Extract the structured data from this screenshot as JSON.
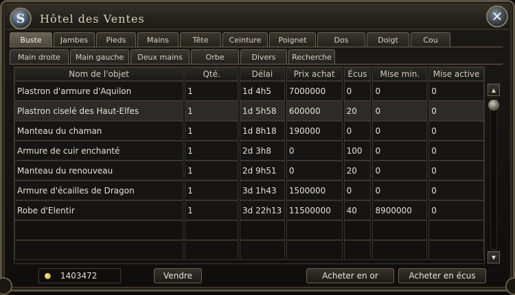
{
  "window": {
    "title": "Hôtel des Ventes"
  },
  "tabs_row1": [
    "Buste",
    "Jambes",
    "Pieds",
    "Mains",
    "Tête",
    "Ceinture",
    "Poignet",
    "Dos",
    "Doigt",
    "Cou"
  ],
  "tabs_row2": [
    "Main droite",
    "Main gauche",
    "Deux mains",
    "Orbe",
    "Divers",
    "Recherche"
  ],
  "table": {
    "columns": [
      "Nom de l'objet",
      "Qté.",
      "Délai",
      "Prix achat",
      "Écus",
      "Mise min.",
      "Mise active"
    ],
    "rows": [
      [
        "Plastron d'armure d'Aquilon",
        "1",
        "1d 4h5",
        "7000000",
        "0",
        "0",
        "0"
      ],
      [
        "Plastron ciselé des Haut-Elfes",
        "1",
        "1d 5h58",
        "600000",
        "20",
        "0",
        "0"
      ],
      [
        "Manteau du chaman",
        "1",
        "1d 8h18",
        "190000",
        "0",
        "0",
        "0"
      ],
      [
        "Armure de cuir enchanté",
        "1",
        "2d 3h8",
        "0",
        "100",
        "0",
        "0"
      ],
      [
        "Manteau du renouveau",
        "1",
        "2d 9h51",
        "0",
        "20",
        "0",
        "0"
      ],
      [
        "Armure d'écailles de Dragon",
        "1",
        "3d 1h43",
        "1500000",
        "0",
        "0",
        "0"
      ],
      [
        "Robe d'Elentir",
        "1",
        "3d 22h13",
        "11500000",
        "40",
        "8900000",
        "0"
      ]
    ]
  },
  "footer": {
    "gold": "1403472",
    "sell_label": "Vendre",
    "buy_gold_label": "Acheter en or",
    "buy_ecus_label": "Acheter en écus"
  },
  "colors": {
    "accent": "#6b624f",
    "selected_row": "#2e2a27",
    "gold": "#d4a830"
  }
}
